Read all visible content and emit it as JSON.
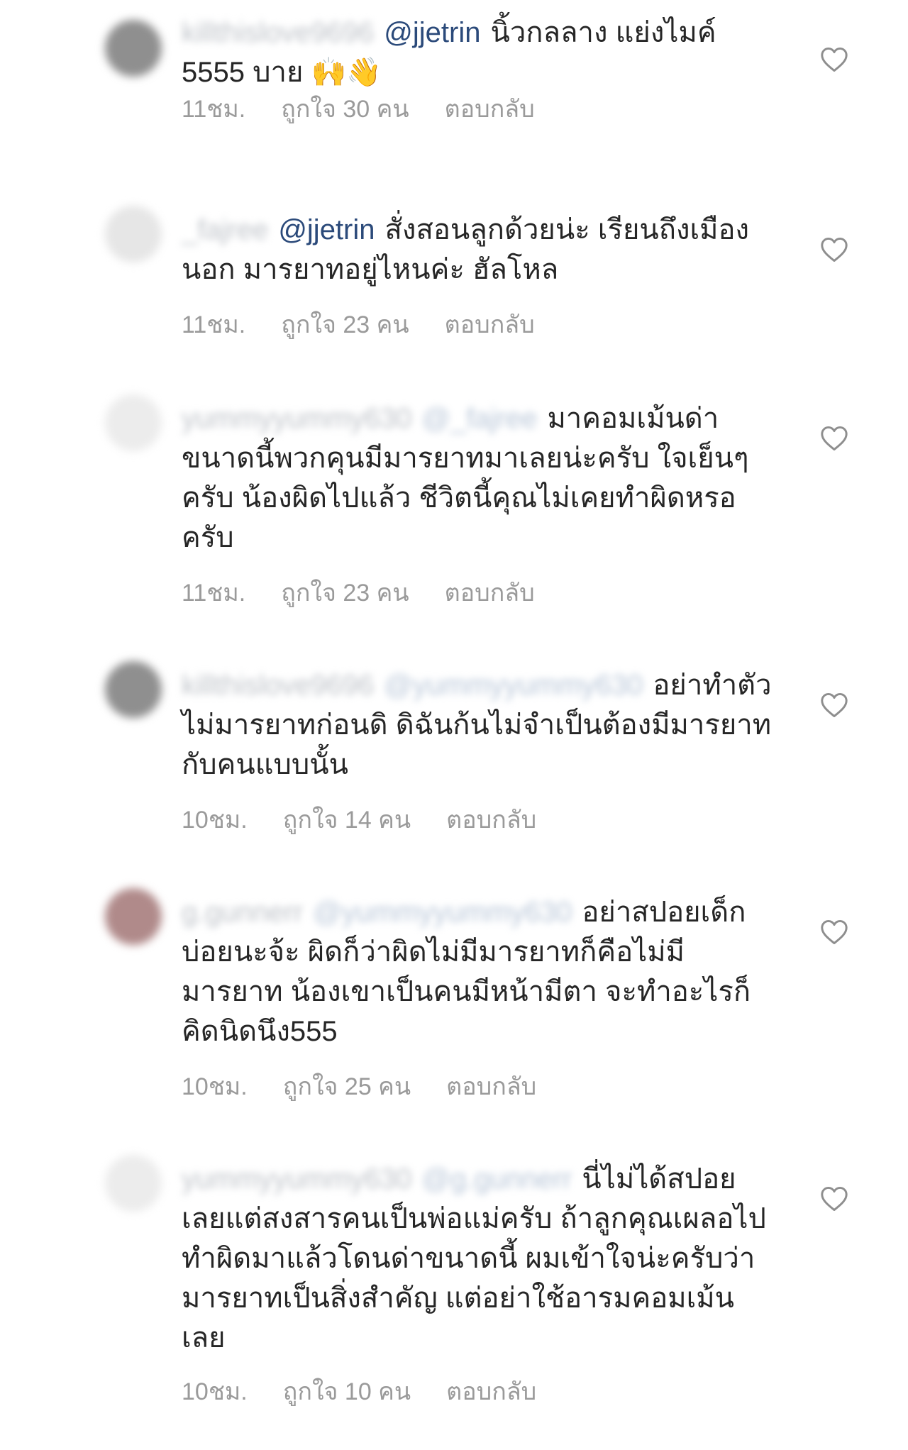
{
  "comments": [
    {
      "username": "killthislove9696",
      "mention": "@jjetrin",
      "mention_blurred": false,
      "text": "นิ้วกลลาง แย่งไมค์ 5555 บาย 🙌👋",
      "time": "11ชม.",
      "likes": "ถูกใจ 30 คน",
      "reply": "ตอบกลับ",
      "avatar_color": "#8f8f8f"
    },
    {
      "username": "_fajree",
      "mention": "@jjetrin",
      "mention_blurred": false,
      "text": "สั่งสอนลูกด้วยน่ะ เรียนถึงเมืองนอก มารยาทอยู่ไหนค่ะ ฮัลโหล",
      "time": "11ชม.",
      "likes": "ถูกใจ 23 คน",
      "reply": "ตอบกลับ",
      "avatar_color": "#e6e6e6"
    },
    {
      "username": "yummyyummy630",
      "mention": "@_fajree",
      "mention_blurred": true,
      "text": "มาคอมเม้นด่าขนาดนี้พวกคุนมีมารยาทมาเลยน่ะครับ  ใจเย็นๆครับ  น้องผิดไปแล้ว ชีวิตนี้คุณไม่เคยทำผิดหรอครับ",
      "time": "11ชม.",
      "likes": "ถูกใจ 23 คน",
      "reply": "ตอบกลับ",
      "avatar_color": "#ececec"
    },
    {
      "username": "killthislove9696",
      "mention": "@yummyyummy630",
      "mention_blurred": true,
      "text": "อย่าทำตัวไม่มารยาทก่อนดิ ดิฉันก้นไม่จำเป็นต้องมีมารยาทกับคนแบบนั้น",
      "time": "10ชม.",
      "likes": "ถูกใจ 14 คน",
      "reply": "ตอบกลับ",
      "avatar_color": "#8f8f8f"
    },
    {
      "username": "g.gunnerr",
      "mention": "@yummyyummy630",
      "mention_blurred": true,
      "text": "อย่าสปอยเด็กบ่อยนะจ้ะ ผิดก็ว่าผิดไม่มีมารยาทก็คือไม่มีมารยาท น้องเขาเป็นคนมีหน้ามีตา จะทำอะไรก็คิดนิดนึง555",
      "time": "10ชม.",
      "likes": "ถูกใจ 25 คน",
      "reply": "ตอบกลับ",
      "avatar_color": "#b08a8a"
    },
    {
      "username": "yummyyummy630",
      "mention": "@g.gunnerr",
      "mention_blurred": true,
      "text": "นี่ไม่ได้สปอยเลยแต่สงสารคนเป็นพ่อแม่ครับ ถ้าลูกคุณเผลอไปทำผิดมาแล้วโดนด่าขนาดนี้ ผมเข้าใจน่ะครับว่ามารยาทเป็นสิ่งสำคัญ แต่อย่าใช้อารมคอมเม้นเลย",
      "time": "10ชม.",
      "likes": "ถูกใจ 10 คน",
      "reply": "ตอบกลับ",
      "avatar_color": "#ececec"
    }
  ]
}
